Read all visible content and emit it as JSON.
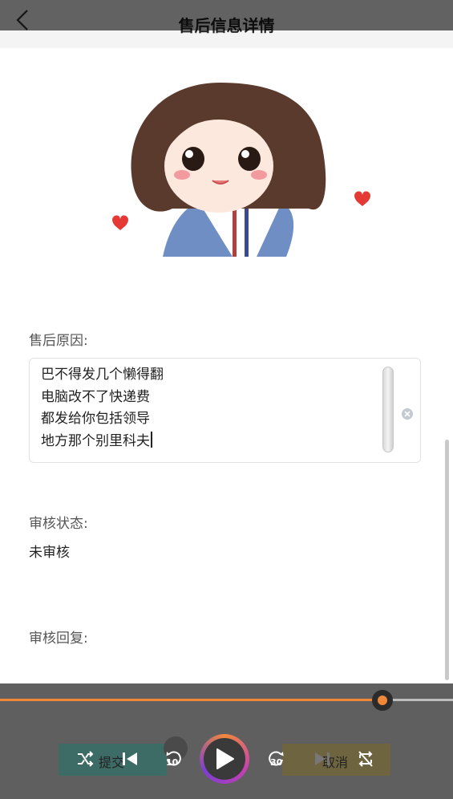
{
  "header": {
    "title": "售后信息详情",
    "back_icon": "chevron-left-icon"
  },
  "form": {
    "reason_label": "售后原因:",
    "reason_lines": [
      "巴不得发几个懒得翻",
      "电脑改不了快递费",
      "都发给你包括领导",
      "地方那个别里科夫"
    ],
    "status_label": "审核状态:",
    "status_value": "未审核",
    "reply_label": "审核回复:"
  },
  "actions": {
    "submit_label": "提交",
    "cancel_label": "取消"
  },
  "player": {
    "progress": 0.845,
    "rewind_seconds": "10",
    "forward_seconds": "30",
    "accent_color": "#f0883a",
    "icons": [
      "shuffle-icon",
      "previous-icon",
      "rewind-10-icon",
      "play-icon",
      "forward-30-icon",
      "next-icon",
      "repeat-off-icon"
    ]
  }
}
